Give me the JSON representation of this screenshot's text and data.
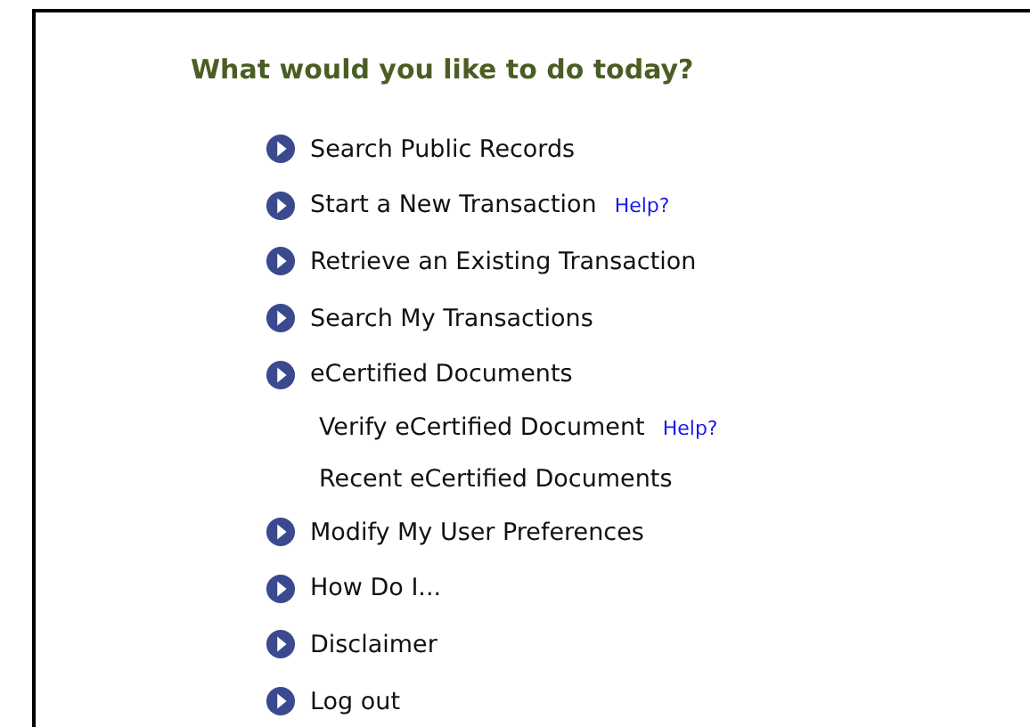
{
  "heading": "What would you like to do today?",
  "items": [
    {
      "kind": "main",
      "label": "Search Public Records"
    },
    {
      "kind": "main",
      "label": "Start a New Transaction",
      "help": "Help?"
    },
    {
      "kind": "main",
      "label": "Retrieve an Existing Transaction"
    },
    {
      "kind": "main",
      "label": "Search My Transactions"
    },
    {
      "kind": "main",
      "label": "eCertified Documents"
    },
    {
      "kind": "sub",
      "label": "Verify eCertified Document",
      "help": "Help?"
    },
    {
      "kind": "sub",
      "label": "Recent eCertified Documents"
    },
    {
      "kind": "main",
      "label": "Modify My User Preferences"
    },
    {
      "kind": "main",
      "label": "How Do I..."
    },
    {
      "kind": "main",
      "label": "Disclaimer"
    },
    {
      "kind": "main",
      "label": "Log out"
    }
  ]
}
